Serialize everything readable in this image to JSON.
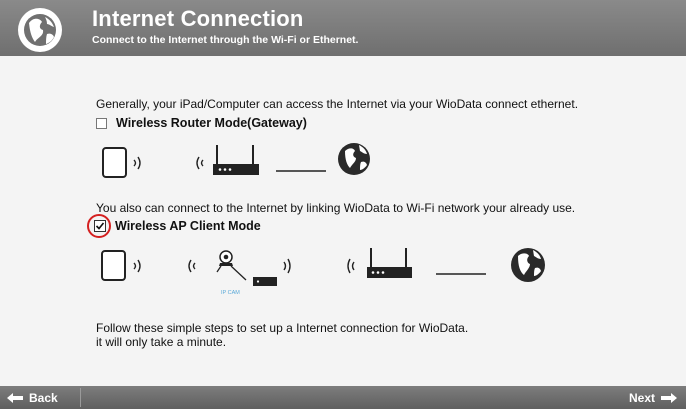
{
  "header": {
    "title": "Internet Connection",
    "subtitle": "Connect to the Internet through the Wi-Fi or Ethernet."
  },
  "intro_text": "Generally, your iPad/Computer can access the Internet via your WioData connect ethernet.",
  "router_mode": {
    "label": "Wireless Router Mode(Gateway)",
    "checked": false
  },
  "client_text": "You also can connect to the Internet by linking WioData to Wi-Fi network your already use.",
  "client_mode": {
    "label": "Wireless AP Client Mode",
    "checked": true
  },
  "camera_label": "IP CAM",
  "footer_text_line1": "Follow these simple steps to set up a Internet connection for WioData.",
  "footer_text_line2": "it will only take a minute.",
  "nav": {
    "back_label": "Back",
    "next_label": "Next"
  },
  "icons": {
    "header": "globe-icon",
    "devices": [
      "tablet-icon",
      "wifi-signal-icon",
      "router-icon",
      "globe-icon",
      "ip-camera-icon",
      "access-point-icon"
    ],
    "nav_back": "arrow-left-icon",
    "nav_next": "arrow-right-icon"
  },
  "colors": {
    "header_bg": "#7a7a7a",
    "content_bg": "#f4f4f4",
    "highlight_ring": "#d42020",
    "camera_text": "#5aa9d8"
  }
}
